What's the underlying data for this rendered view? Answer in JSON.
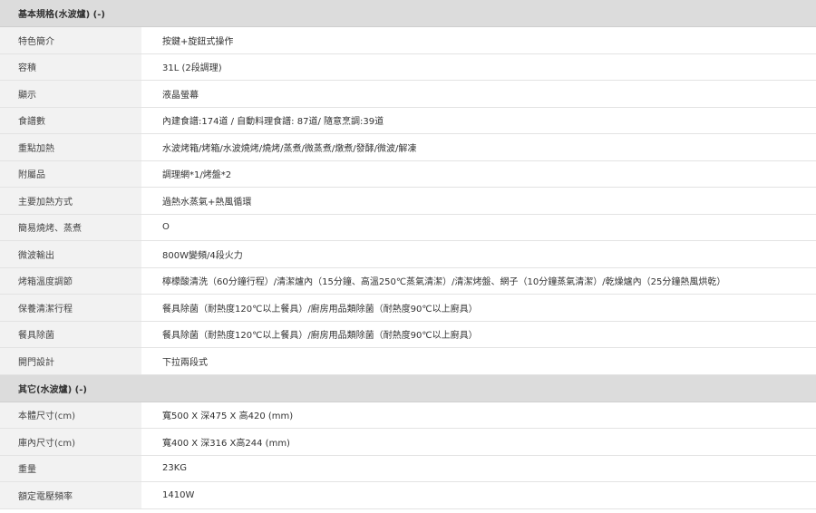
{
  "sections": [
    {
      "title": "基本規格(水波爐) (-)",
      "rows": [
        {
          "label": "特色簡介",
          "value": "按鍵+旋鈕式操作"
        },
        {
          "label": "容積",
          "value": "31L (2段調理)"
        },
        {
          "label": "顯示",
          "value": "液晶螢幕"
        },
        {
          "label": "食譜數",
          "value": "內建食譜:174道 / 自動料理食譜: 87道/ 隨意烹調:39道"
        },
        {
          "label": "重點加熱",
          "value": "水波烤箱/烤箱/水波燒烤/燒烤/蒸煮/微蒸煮/燉煮/發酵/微波/解凍"
        },
        {
          "label": "附屬品",
          "value": "調理網*1/烤盤*2"
        },
        {
          "label": "主要加熱方式",
          "value": "過熱水蒸氣+熱風循環"
        },
        {
          "label": "簡易燒烤、蒸煮",
          "value": "O"
        },
        {
          "label": "微波輸出",
          "value": "800W變頻/4段火力"
        },
        {
          "label": "烤箱溫度調節",
          "value": "檸檬酸清洗（60分鐘行程）/清潔爐內（15分鐘、高溫250℃蒸氣清潔）/清潔烤盤、網子（10分鐘蒸氣清潔）/乾燥爐內（25分鐘熱風烘乾）"
        },
        {
          "label": "保養清潔行程",
          "value": "餐具除菌（耐熱度120℃以上餐具）/廚房用品類除菌（耐熱度90℃以上廚具）"
        },
        {
          "label": "餐具除菌",
          "value": "餐具除菌（耐熱度120℃以上餐具）/廚房用品類除菌（耐熱度90℃以上廚具）"
        },
        {
          "label": "開門設計",
          "value": "下拉兩段式"
        }
      ]
    },
    {
      "title": "其它(水波爐) (-)",
      "rows": [
        {
          "label": "本體尺寸(cm)",
          "value": "寬500 X 深475 X 高420 (mm)"
        },
        {
          "label": "庫內尺寸(cm)",
          "value": "寬400 X 深316 X高244 (mm)"
        },
        {
          "label": "重量",
          "value": "23KG"
        },
        {
          "label": "額定電壓頻率",
          "value": "1410W"
        }
      ]
    }
  ]
}
